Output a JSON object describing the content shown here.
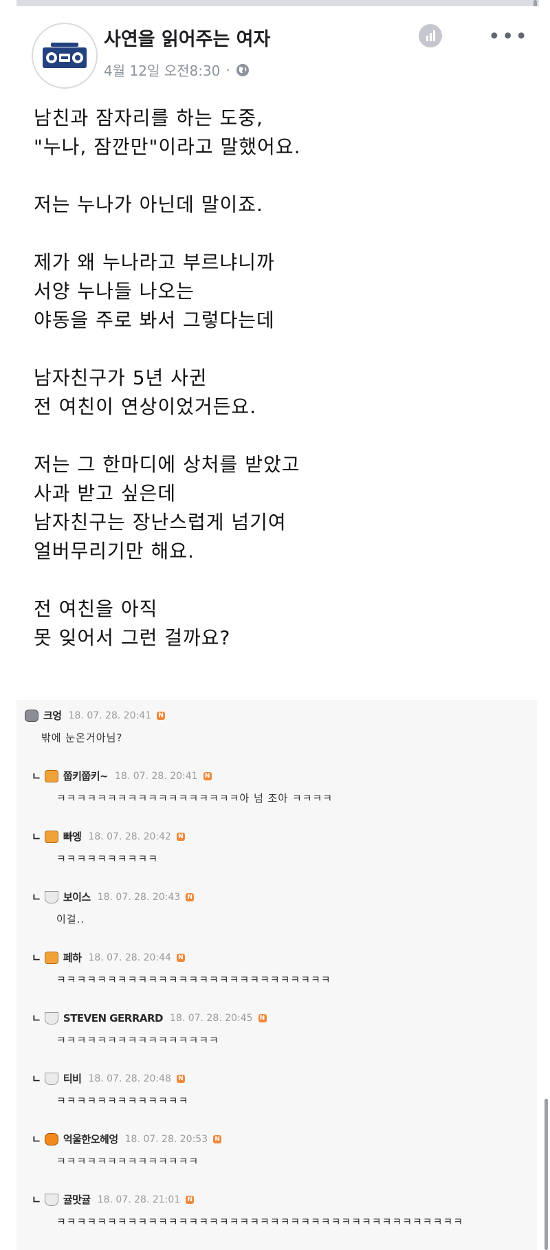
{
  "post": {
    "author": "사연을 읽어주는 여자",
    "date": "4월 12일 오전8:30",
    "separator": "·",
    "icons": {
      "avatar": "boombox-icon",
      "privacy": "globe-icon",
      "stats": "stats-icon",
      "more": "more-icon"
    },
    "more_glyph": "•••",
    "text": "남친과 잠자리를 하는 도중,\n\"누나, 잠깐만\"이라고 말했어요.\n\n저는 누나가 아닌데 말이죠.\n\n제가 왜 누나라고 부르냐니까\n서양 누나들 나오는\n야동을 주로 봐서 그렇다는데\n\n남자친구가 5년 사귄\n전 여친이 연상이었거든요.\n\n저는 그 한마디에 상처를 받았고\n사과 받고 싶은데\n남자친구는 장난스럽게 넘기여\n얼버무리기만 해요.\n\n전 여친을 아직\n못 잊어서 그런 걸까요?"
  },
  "comments": [
    {
      "reply": false,
      "icon": "bear",
      "name": "크엉",
      "date": "18. 07. 28.  20:41",
      "badge": "N",
      "text": "밖에 눈온거아님?"
    },
    {
      "reply": true,
      "icon": "cat",
      "name": "쭙키쭙키~",
      "date": "18. 07. 28.  20:41",
      "badge": "N",
      "text": "ㅋㅋㅋㅋㅋㅋㅋㅋㅋㅋㅋㅋㅋㅋㅋㅋㅋㅋ아 넘 조아 ㅋㅋㅋㅋ"
    },
    {
      "reply": true,
      "icon": "cat",
      "name": "빠엥",
      "date": "18. 07. 28.  20:42",
      "badge": "N",
      "text": "ㅋㅋㅋㅋㅋㅋㅋㅋㅋㅋ"
    },
    {
      "reply": true,
      "icon": "pot",
      "name": "보이스",
      "date": "18. 07. 28.  20:43",
      "badge": "N",
      "text": "이걸.."
    },
    {
      "reply": true,
      "icon": "cat",
      "name": "페하",
      "date": "18. 07. 28.  20:44",
      "badge": "N",
      "text": "ㅋㅋㅋㅋㅋㅋㅋㅋㅋㅋㅋㅋㅋㅋㅋㅋㅋㅋㅋㅋㅋㅋㅋㅋㅋㅋㅋ"
    },
    {
      "reply": true,
      "icon": "pot",
      "name": "STEVEN GERRARD",
      "date": "18. 07. 28.  20:45",
      "badge": "N",
      "text": "ㅋㅋㅋㅋㅋㅋㅋㅋㅋㅋㅋㅋㅋㅋㅋㅋ"
    },
    {
      "reply": true,
      "icon": "pot",
      "name": "티비",
      "date": "18. 07. 28.  20:48",
      "badge": "N",
      "text": "ㅋㅋㅋㅋㅋㅋㅋㅋㅋㅋㅋㅋㅋ"
    },
    {
      "reply": true,
      "icon": "tiger",
      "name": "억울한오헤엉",
      "date": "18. 07. 28.  20:53",
      "badge": "N",
      "text": "ㅋㅋㅋㅋㅋㅋㅋㅋㅋㅋㅋㅋㅋㅋ"
    },
    {
      "reply": true,
      "icon": "pot",
      "name": "귤맛귤",
      "date": "18. 07. 28.  21:01",
      "badge": "N",
      "text": "ㅋㅋㅋㅋㅋㅋㅋㅋㅋㅋㅋㅋㅋㅋㅋㅋㅋㅋㅋㅋㅋㅋㅋㅋㅋㅋㅋㅋㅋㅋㅋㅋㅋㅋㅋㅋㅋㅋㅋㅋ"
    }
  ]
}
